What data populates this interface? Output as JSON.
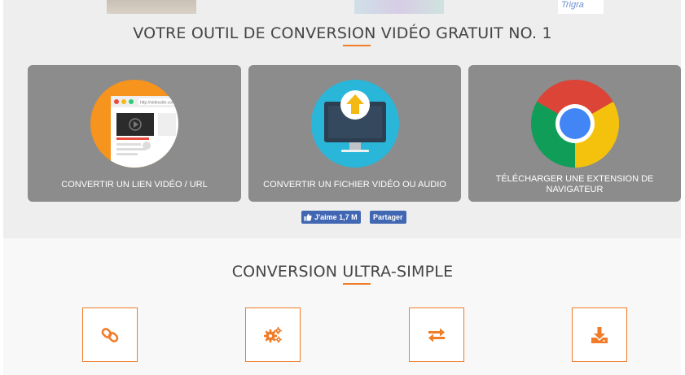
{
  "top_banner": {
    "right_text": "Trigra"
  },
  "section1": {
    "title": "VOTRE OUTIL DE CONVERSION VIDÉO GRATUIT NO. 1"
  },
  "cards": [
    {
      "label": "CONVERTIR UN LIEN VIDÉO / URL",
      "icon": "browser-video-icon",
      "url_text": "http://videosite.com"
    },
    {
      "label": "CONVERTIR UN FICHIER VIDÉO OU AUDIO",
      "icon": "monitor-upload-icon"
    },
    {
      "label": "TÉLÉCHARGER UNE EXTENSION DE NAVIGATEUR",
      "icon": "chrome-icon"
    }
  ],
  "facebook": {
    "like_label": "J'aime 1,7 M",
    "share_label": "Partager",
    "color": "#4267b2"
  },
  "section2": {
    "title": "CONVERSION ULTRA-SIMPLE",
    "steps": [
      {
        "icon": "link-icon"
      },
      {
        "icon": "gears-icon"
      },
      {
        "icon": "exchange-arrows-icon"
      },
      {
        "icon": "download-icon"
      }
    ]
  },
  "colors": {
    "accent": "#f07c28",
    "card_bg": "#8c8c8c",
    "section_bg": "#eeeeee"
  }
}
